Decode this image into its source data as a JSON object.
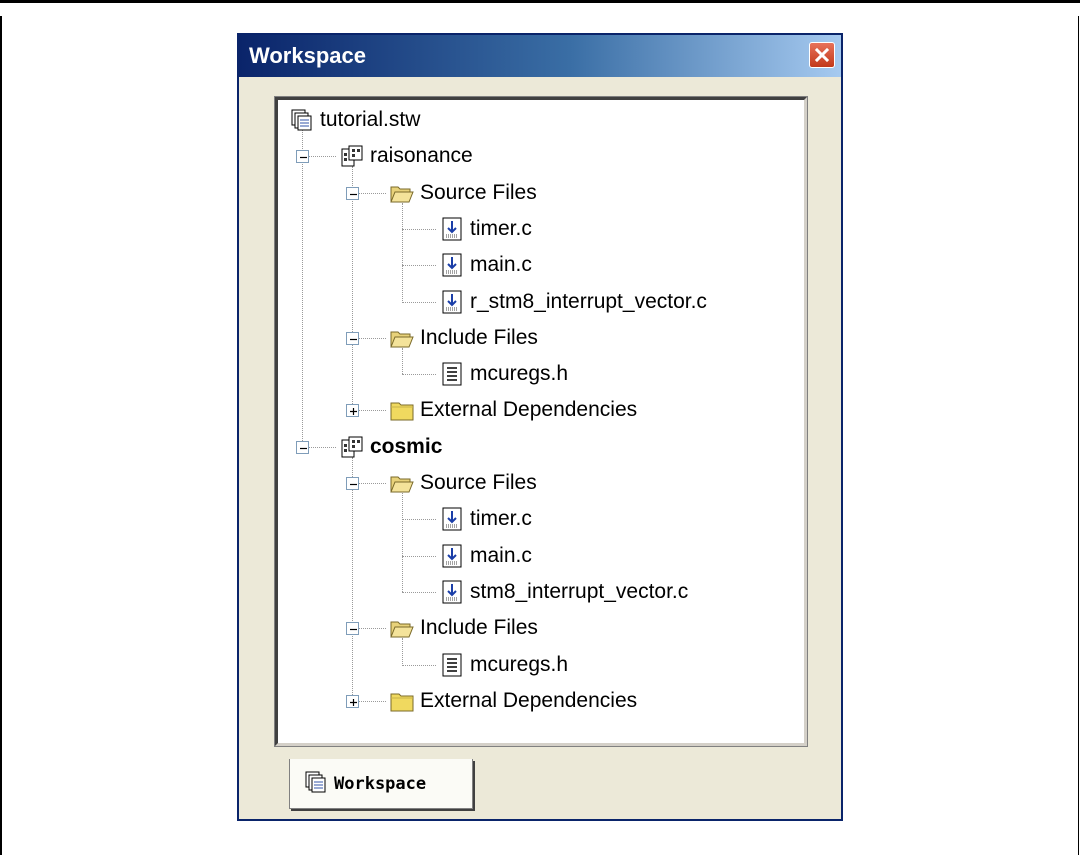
{
  "window": {
    "title": "Workspace"
  },
  "tree": [
    {
      "id": "r0",
      "label": "tutorial.stw",
      "icon": "workspace-icon",
      "level": 0
    },
    {
      "id": "r1",
      "label": "raisonance",
      "icon": "project-icon",
      "level": 1,
      "toggle": "minus",
      "bold": false
    },
    {
      "id": "r2",
      "label": "Source Files",
      "icon": "folder-open-icon",
      "level": 2,
      "toggle": "minus"
    },
    {
      "id": "r3",
      "label": "timer.c",
      "icon": "c-file-icon",
      "level": 3
    },
    {
      "id": "r4",
      "label": "main.c",
      "icon": "c-file-icon",
      "level": 3
    },
    {
      "id": "r5",
      "label": "r_stm8_interrupt_vector.c",
      "icon": "c-file-icon",
      "level": 3
    },
    {
      "id": "r6",
      "label": "Include Files",
      "icon": "folder-open-icon",
      "level": 2,
      "toggle": "minus"
    },
    {
      "id": "r7",
      "label": "mcuregs.h",
      "icon": "header-file-icon",
      "level": 3
    },
    {
      "id": "r8",
      "label": "External Dependencies",
      "icon": "folder-closed-icon",
      "level": 2,
      "toggle": "plus"
    },
    {
      "id": "r9",
      "label": "cosmic",
      "icon": "project-icon",
      "level": 1,
      "toggle": "minus",
      "bold": true
    },
    {
      "id": "r10",
      "label": "Source Files",
      "icon": "folder-open-icon",
      "level": 2,
      "toggle": "minus"
    },
    {
      "id": "r11",
      "label": "timer.c",
      "icon": "c-file-icon",
      "level": 3
    },
    {
      "id": "r12",
      "label": "main.c",
      "icon": "c-file-icon",
      "level": 3
    },
    {
      "id": "r13",
      "label": "stm8_interrupt_vector.c",
      "icon": "c-file-icon",
      "level": 3
    },
    {
      "id": "r14",
      "label": "Include Files",
      "icon": "folder-open-icon",
      "level": 2,
      "toggle": "minus"
    },
    {
      "id": "r15",
      "label": "mcuregs.h",
      "icon": "header-file-icon",
      "level": 3
    },
    {
      "id": "r16",
      "label": "External Dependencies",
      "icon": "folder-closed-icon",
      "level": 2,
      "toggle": "plus"
    }
  ],
  "tab": {
    "label": "Workspace",
    "icon": "workspace-icon"
  },
  "colors": {
    "titlebar_start": "#0a246a",
    "titlebar_end": "#a6caf0",
    "window_bg": "#ece9d8",
    "close_button": "#c2391a"
  }
}
